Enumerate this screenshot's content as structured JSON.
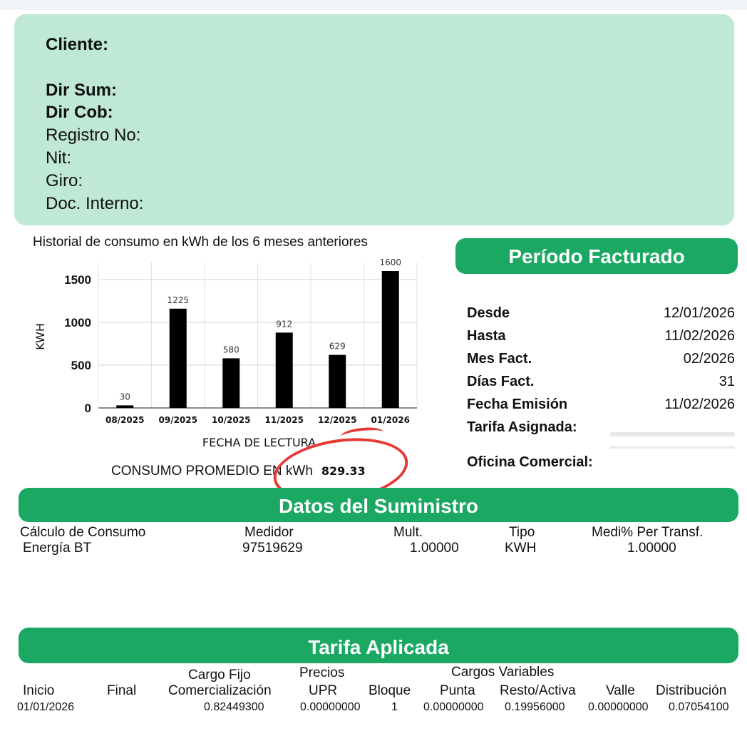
{
  "client": {
    "cliente_label": "Cliente:",
    "dir_sum_label": "Dir Sum:",
    "dir_cob_label": "Dir Cob:",
    "registro_label": "Registro No:",
    "nit_label": "Nit:",
    "giro_label": "Giro:",
    "doc_label": "Doc. Interno:"
  },
  "chart_title": "Historial de consumo en kWh de los 6 meses anteriores",
  "chart_data": {
    "type": "bar",
    "categories": [
      "08/2025",
      "09/2025",
      "10/2025",
      "11/2025",
      "12/2025",
      "01/2026"
    ],
    "values": [
      30,
      1160,
      580,
      880,
      620,
      1600
    ],
    "data_labels": [
      "30",
      "1225",
      "580",
      "912",
      "629",
      "1600"
    ],
    "xlabel": "FECHA DE LECTURA",
    "ylabel": "KWH",
    "ylim": [
      0,
      1700
    ],
    "yticks": [
      "0",
      "500",
      "1000",
      "1500"
    ],
    "grid": true,
    "bar_color": "#000000"
  },
  "average": {
    "label": "CONSUMO PROMEDIO EN kWh",
    "value": "829.33"
  },
  "periodo": {
    "title": "Período Facturado",
    "rows": [
      {
        "k": "Desde",
        "v": "12/01/2026"
      },
      {
        "k": "Hasta",
        "v": "11/02/2026"
      },
      {
        "k": "Mes Fact.",
        "v": "02/2026"
      },
      {
        "k": "Días Fact.",
        "v": "31"
      },
      {
        "k": "Fecha Emisión",
        "v": "11/02/2026"
      },
      {
        "k": "Tarifa Asignada:",
        "v": ""
      }
    ],
    "oficina_label": "Oficina Comercial:"
  },
  "datos": {
    "title": "Datos del Suministro",
    "headers": [
      "Cálculo de Consumo",
      "Medidor",
      "Mult.",
      "Tipo",
      "Medi% Per Transf."
    ],
    "values": [
      "Energía BT",
      "97519629",
      "1.00000",
      "KWH",
      "1.00000"
    ]
  },
  "tarifa": {
    "title": "Tarifa Aplicada",
    "group_cargo_fijo": "Cargo Fijo",
    "group_precios": "Precios",
    "group_variables": "Cargos Variables",
    "headers": [
      "Inicio",
      "Final",
      "Comercialización",
      "UPR",
      "Bloque",
      "Punta",
      "Resto/Activa",
      "Valle",
      "Distribución"
    ],
    "values": [
      "01/01/2026",
      "",
      "0.82449300",
      "0.00000000",
      "1",
      "0.00000000",
      "0.19956000",
      "0.00000000",
      "0.07054100"
    ]
  },
  "colors": {
    "green": "#1aa862",
    "mint": "#bfe8d5",
    "annotation_red": "#e53935"
  }
}
